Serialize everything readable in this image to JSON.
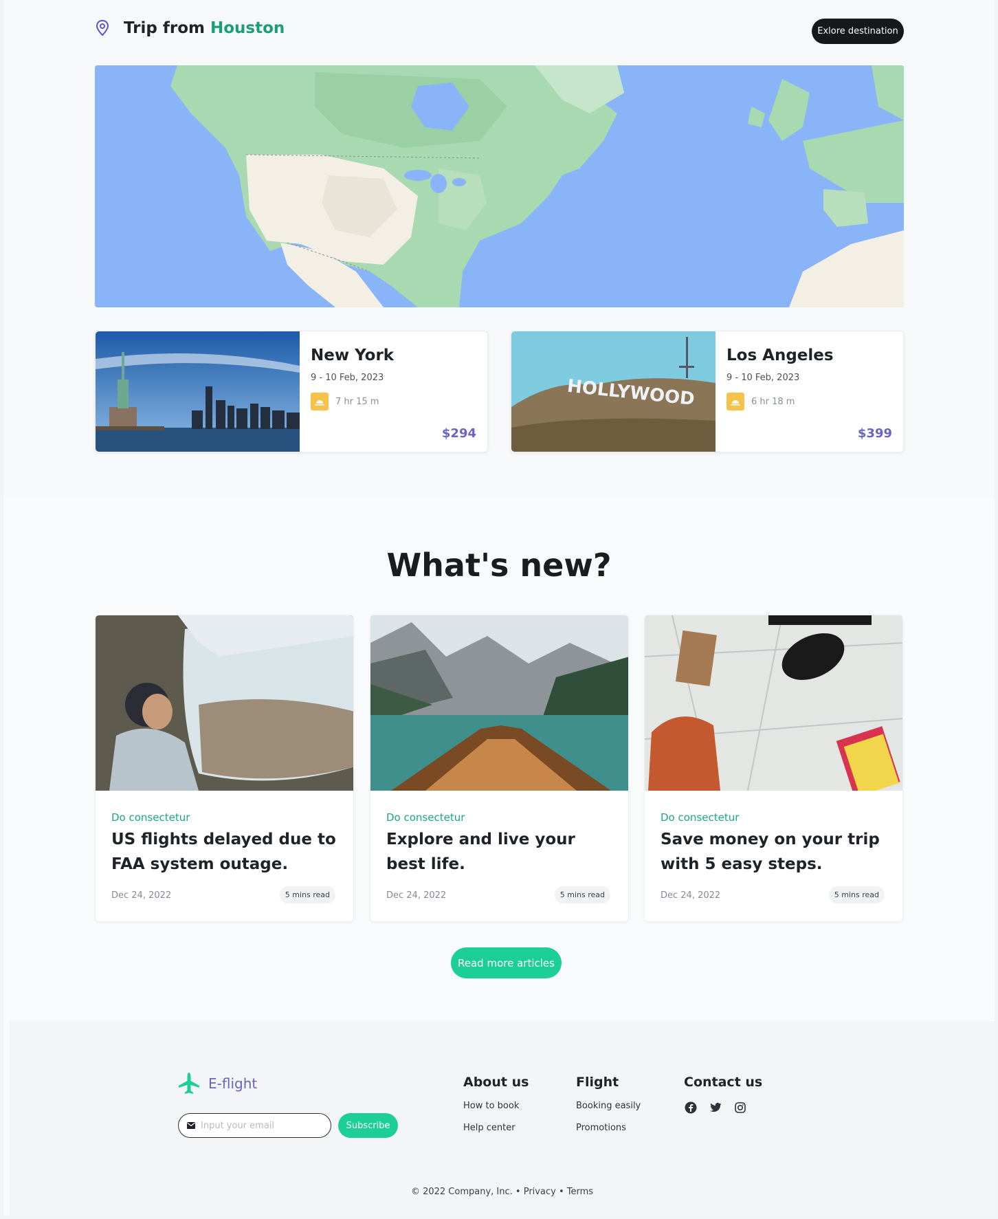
{
  "header": {
    "title_prefix": "Trip from",
    "title_city": "Houston",
    "explore_label": "Exlore destination"
  },
  "destinations": [
    {
      "name": "New York",
      "dates": "9 - 10 Feb, 2023",
      "duration": "7 hr 15 m",
      "price": "$294"
    },
    {
      "name": "Los Angeles",
      "dates": "9 - 10 Feb, 2023",
      "duration": "6 hr 18 m",
      "price": "$399"
    }
  ],
  "news": {
    "title": "What's new?",
    "articles": [
      {
        "category": "Do consectetur",
        "headline": "US flights delayed due to FAA system outage.",
        "date": "Dec 24, 2022",
        "read_time": "5 mins read"
      },
      {
        "category": "Do consectetur",
        "headline": "Explore and live your best life.",
        "date": "Dec 24, 2022",
        "read_time": "5 mins read"
      },
      {
        "category": "Do consectetur",
        "headline": "Save money on your trip with 5 easy steps.",
        "date": "Dec 24, 2022",
        "read_time": "5 mins read"
      }
    ],
    "read_more_label": "Read more articles"
  },
  "footer": {
    "brand": "E-flight",
    "email_placeholder": "Input your email",
    "subscribe_label": "Subscribe",
    "about": {
      "title": "About us",
      "links": [
        "How to book",
        "Help center"
      ]
    },
    "flight": {
      "title": "Flight",
      "links": [
        "Booking easily",
        "Promotions"
      ]
    },
    "contact": {
      "title": "Contact us",
      "icons": [
        "facebook-icon",
        "twitter-icon",
        "instagram-icon"
      ]
    },
    "copyright": "© 2022 Company, Inc.",
    "privacy": "Privacy",
    "terms": "Terms",
    "separator": "•"
  },
  "colors": {
    "accent_green": "#1ccf95",
    "city_green": "#1a9e74",
    "brand_purple": "#6a63c5",
    "dark": "#16181c"
  }
}
